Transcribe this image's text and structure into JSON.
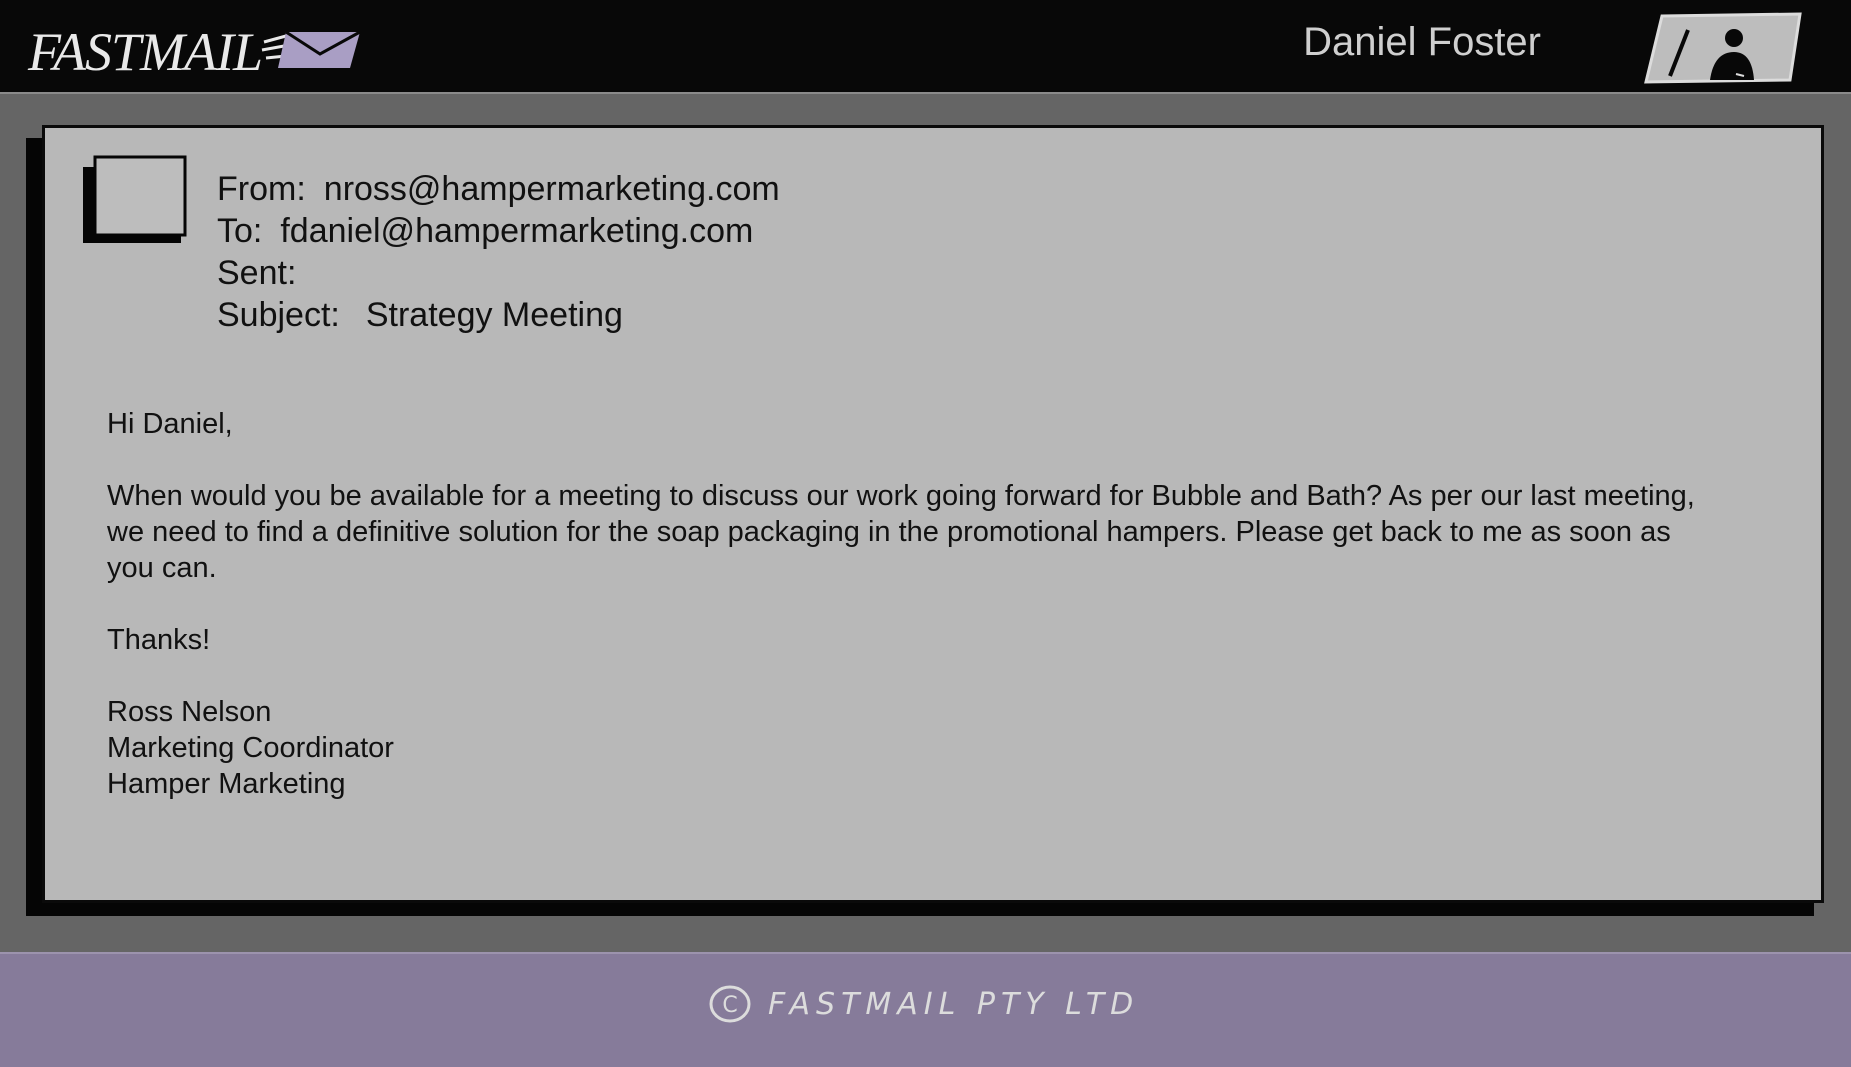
{
  "header": {
    "logo_text": "FASTMAIL",
    "user_name": "Daniel Foster",
    "accent_color": "#a99ec4"
  },
  "email": {
    "from_label": "From:",
    "from_value": "nross@hampermarketing.com",
    "to_label": "To:",
    "to_value": "fdaniel@hampermarketing.com",
    "sent_label": "Sent:",
    "sent_value": "",
    "subject_label": "Subject:",
    "subject_value": "Strategy Meeting",
    "greeting": "Hi Daniel,",
    "body_line_1": "When would you be available for a meeting to discuss our work going forward for Bubble and Bath? As per our last meeting,",
    "body_line_2": "we need to find a definitive solution for the soap packaging in the promotional hampers. Please get back to me as soon as",
    "body_line_3": "you can.",
    "closing": "Thanks!",
    "signature_name": "Ross Nelson",
    "signature_title": "Marketing Coordinator",
    "signature_company": "Hamper Marketing"
  },
  "footer": {
    "copyright_symbol": "C",
    "copyright_text": "FASTMAIL PTY LTD"
  },
  "icons": {
    "logo_envelope": "envelope-icon",
    "user_avatar": "user-avatar-icon",
    "sender_avatar": "sender-avatar-placeholder-icon",
    "copyright": "copyright-icon"
  }
}
